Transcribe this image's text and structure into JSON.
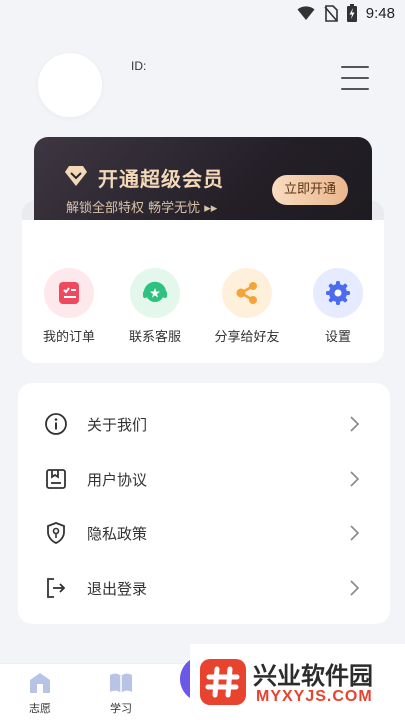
{
  "status_bar": {
    "time": "9:48"
  },
  "profile": {
    "id_label": "ID:"
  },
  "vip": {
    "title": "开通超级会员",
    "subtitle": "解锁全部特权 畅学无忧 ▸▸",
    "button_label": "立即开通",
    "accent": "#f3d9b8"
  },
  "shortcuts": [
    {
      "label": "我的订单",
      "icon": "order-icon",
      "color": "#f0485e",
      "bg": "#fde8eb"
    },
    {
      "label": "联系客服",
      "icon": "customer-service-icon",
      "color": "#2ec27e",
      "bg": "#e3f7ec"
    },
    {
      "label": "分享给好友",
      "icon": "share-icon",
      "color": "#f5a43a",
      "bg": "#fff0dc"
    },
    {
      "label": "设置",
      "icon": "gear-icon",
      "color": "#4c6cf0",
      "bg": "#e6ebff"
    }
  ],
  "settings": [
    {
      "label": "关于我们",
      "icon": "info-icon"
    },
    {
      "label": "用户协议",
      "icon": "agreement-icon"
    },
    {
      "label": "隐私政策",
      "icon": "privacy-shield-icon"
    },
    {
      "label": "退出登录",
      "icon": "logout-icon"
    }
  ],
  "bottom_nav": [
    {
      "label": "志愿",
      "icon": "school-icon"
    },
    {
      "label": "学习",
      "icon": "book-icon"
    }
  ],
  "watermark": {
    "title": "兴业软件园",
    "url": "MYXYJS.COM"
  }
}
